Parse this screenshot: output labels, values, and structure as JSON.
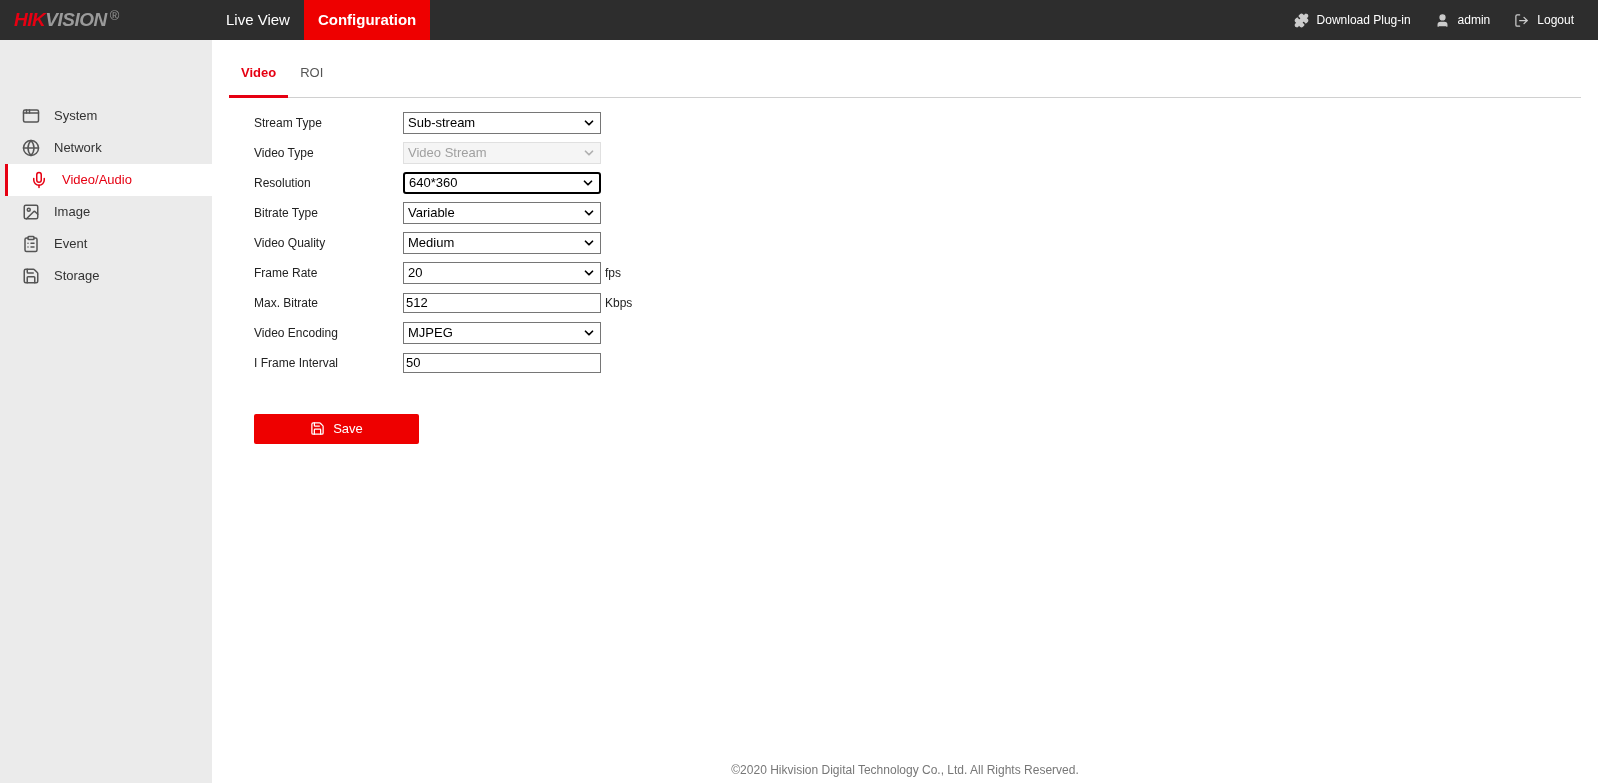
{
  "header": {
    "logo": {
      "part_1": "HIK",
      "part_2": "VISION",
      "mark": "®"
    },
    "nav": [
      {
        "label": "Live View",
        "selected": false
      },
      {
        "label": "Configuration",
        "selected": true
      }
    ],
    "actions": [
      {
        "label": "Download Plug-in"
      },
      {
        "label": "admin"
      },
      {
        "label": "Logout"
      }
    ]
  },
  "sidebar": {
    "items": [
      {
        "label": "System",
        "selected": false
      },
      {
        "label": "Network",
        "selected": false
      },
      {
        "label": "Video/Audio",
        "selected": true
      },
      {
        "label": "Image",
        "selected": false
      },
      {
        "label": "Event",
        "selected": false
      },
      {
        "label": "Storage",
        "selected": false
      }
    ]
  },
  "tabs": [
    {
      "label": "Video",
      "selected": true
    },
    {
      "label": "ROI",
      "selected": false
    }
  ],
  "form": [
    {
      "label": "Stream Type",
      "kind": "select",
      "value": "Sub-stream",
      "disabled": false,
      "focused": false
    },
    {
      "label": "Video Type",
      "kind": "select",
      "value": "Video Stream",
      "disabled": true,
      "focused": false
    },
    {
      "label": "Resolution",
      "kind": "select",
      "value": "640*360",
      "disabled": false,
      "focused": true
    },
    {
      "label": "Bitrate Type",
      "kind": "select",
      "value": "Variable",
      "disabled": false,
      "focused": false
    },
    {
      "label": "Video Quality",
      "kind": "select",
      "value": "Medium",
      "disabled": false,
      "focused": false
    },
    {
      "label": "Frame Rate",
      "kind": "select",
      "value": "20",
      "unit": "fps",
      "disabled": false,
      "focused": false
    },
    {
      "label": "Max. Bitrate",
      "kind": "input",
      "value": "512",
      "unit": "Kbps",
      "disabled": false,
      "focused": false
    },
    {
      "label": "Video Encoding",
      "kind": "select",
      "value": "MJPEG",
      "disabled": false,
      "focused": false
    },
    {
      "label": "I Frame Interval",
      "kind": "input",
      "value": "50",
      "disabled": false,
      "focused": false
    }
  ],
  "save_button": {
    "label": "Save"
  },
  "footer": {
    "text": "©2020 Hikvision Digital Technology Co., Ltd. All Rights Reserved."
  }
}
